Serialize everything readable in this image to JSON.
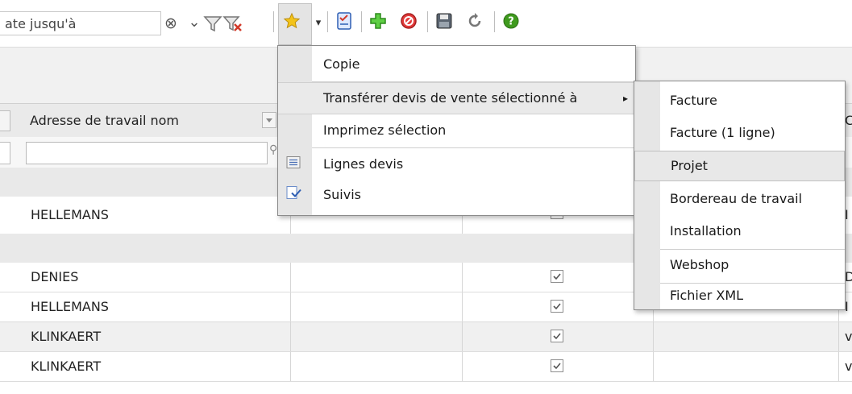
{
  "toolbar": {
    "filter_text": "ate jusqu'à",
    "clear_glyph": "⊗",
    "dropdown_glyph": "⌄",
    "icons": [
      "filter-icon",
      "clear-filter-icon",
      "favorites-star-icon",
      "checklist-icon",
      "add-plus-icon",
      "delete-stop-icon",
      "save-disk-icon",
      "refresh-icon",
      "help-icon"
    ],
    "star_dropdown_glyph": "▾"
  },
  "grid": {
    "header": {
      "col_address": "Adresse de travail nom"
    },
    "rows": [
      {
        "name": "HELLEMANS",
        "checked": false,
        "edge": "I"
      },
      {
        "name": "DENIES",
        "checked": true,
        "edge": "D"
      },
      {
        "name": "HELLEMANS",
        "checked": true,
        "edge": "I"
      },
      {
        "name": "KLINKAERT",
        "checked": true,
        "edge": "v"
      },
      {
        "name": "KLINKAERT",
        "checked": true,
        "edge": "v"
      }
    ],
    "header_edge": "C"
  },
  "context_menu": {
    "copy": "Copie",
    "transfer": "Transférer devis de vente sélectionné à",
    "transfer_arrow": "▸",
    "print": "Imprimez sélection",
    "lines": "Lignes devis",
    "follow_ups": "Suivis"
  },
  "submenu": {
    "items": [
      "Facture",
      "Facture (1 ligne)",
      "Projet",
      "Bordereau de travail",
      "Installation",
      "Webshop",
      "Fichier XML"
    ],
    "hovered": "Projet"
  },
  "colors": {
    "help_green": "#3f9a1e",
    "add_green": "#3cae2a",
    "delete_red": "#e23b3b",
    "star_yellow": "#f3c31a",
    "checklist_blue": "#2f5fb3"
  }
}
